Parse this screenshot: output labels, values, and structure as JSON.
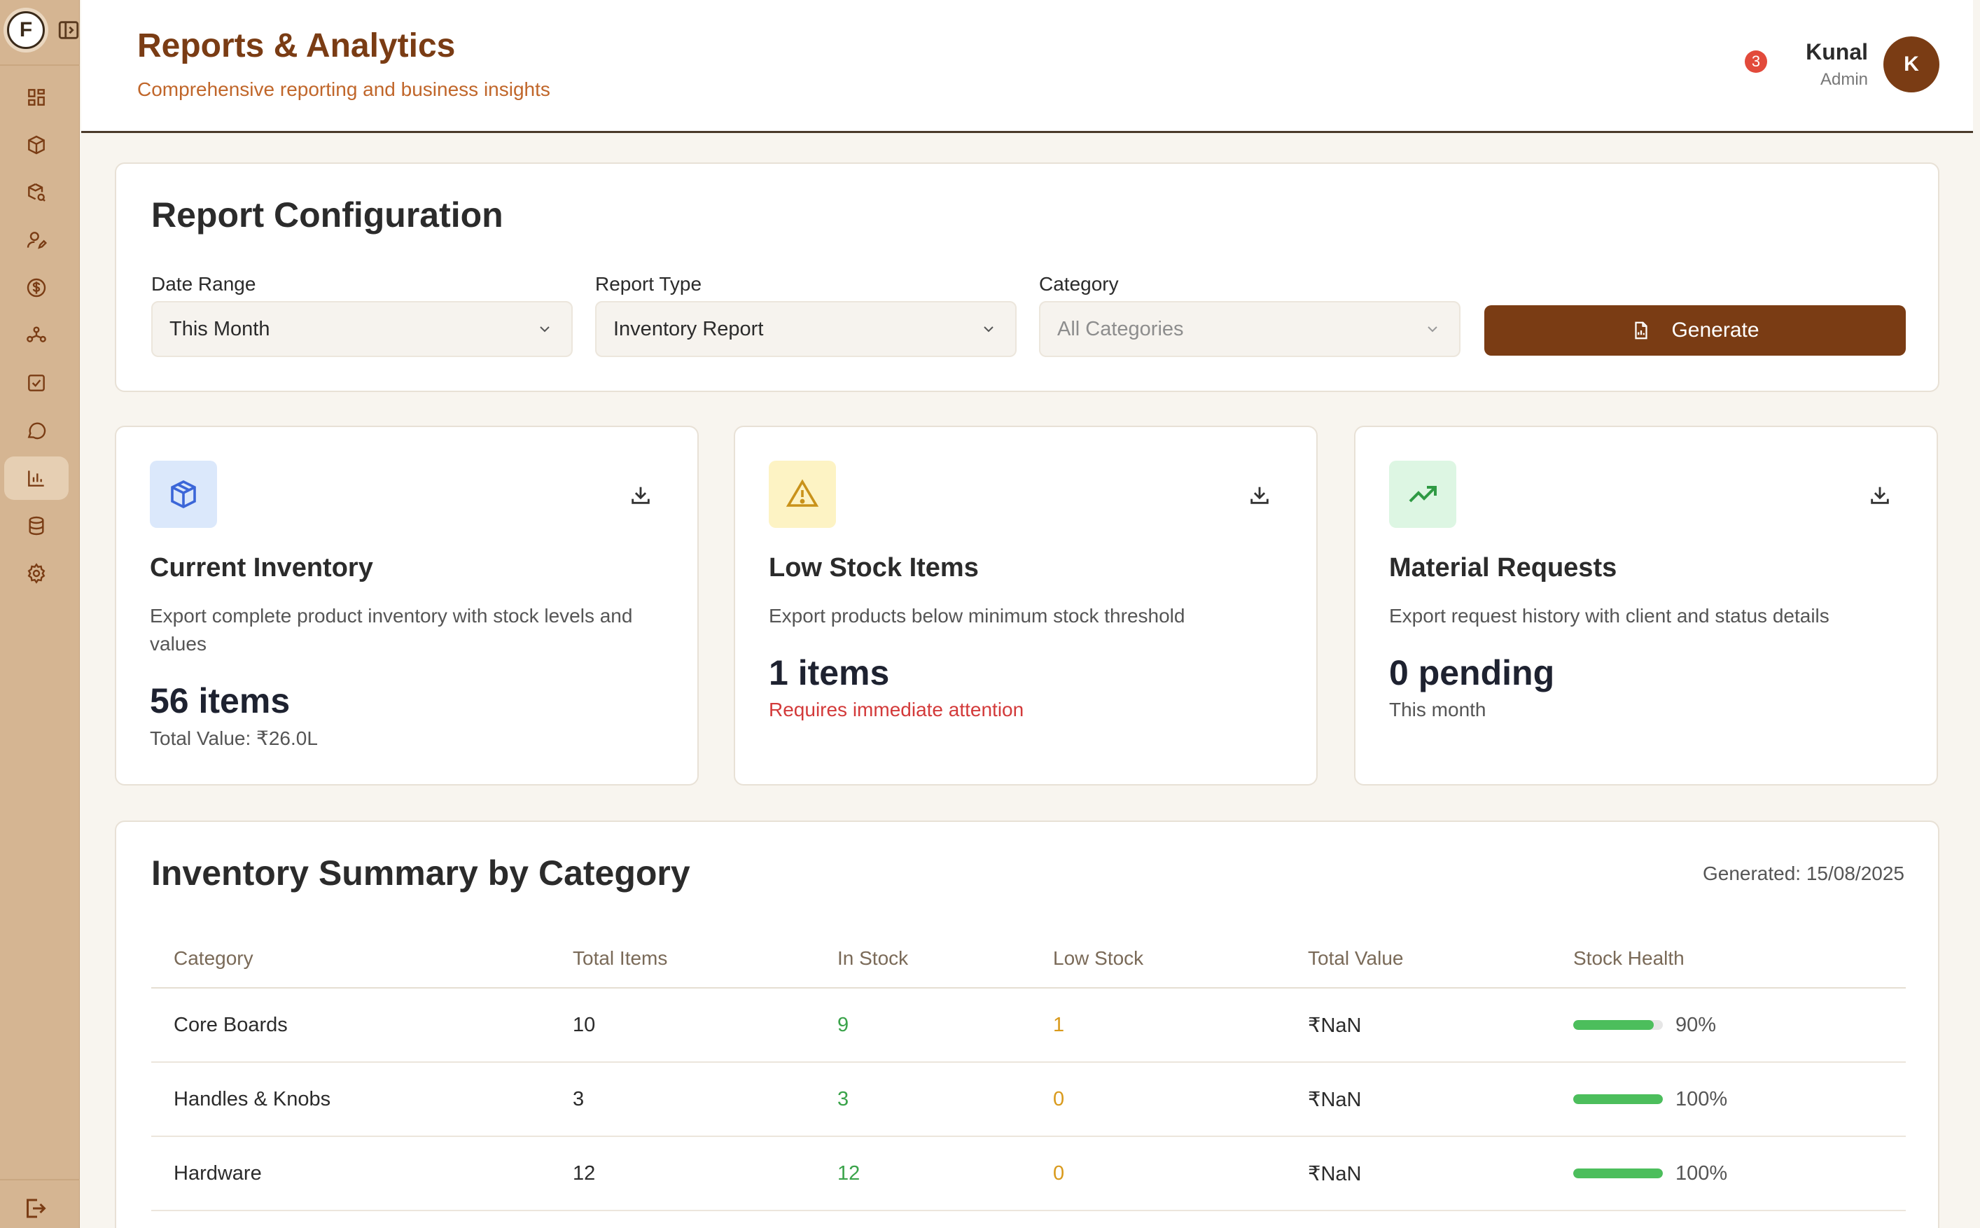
{
  "sidebar": {
    "logo_letter": "F",
    "nav": [
      {
        "icon": "dashboard-grid-icon"
      },
      {
        "icon": "box-icon"
      },
      {
        "icon": "box-search-icon"
      },
      {
        "icon": "user-edit-icon"
      },
      {
        "icon": "dollar-circle-icon"
      },
      {
        "icon": "network-icon"
      },
      {
        "icon": "check-square-icon"
      },
      {
        "icon": "chat-bubble-icon"
      },
      {
        "icon": "bar-chart-icon",
        "active": true
      },
      {
        "icon": "database-icon"
      },
      {
        "icon": "gear-icon"
      }
    ],
    "logout_icon": "logout-icon"
  },
  "header": {
    "title": "Reports & Analytics",
    "subtitle": "Comprehensive reporting and business insights",
    "notification_count": "3",
    "user_name": "Kunal",
    "user_role": "Admin",
    "avatar_letter": "K"
  },
  "config": {
    "title": "Report Configuration",
    "date_range_label": "Date Range",
    "date_range_value": "This Month",
    "report_type_label": "Report Type",
    "report_type_value": "Inventory Report",
    "category_label": "Category",
    "category_value": "All Categories",
    "generate_label": "Generate"
  },
  "stats": [
    {
      "title": "Current Inventory",
      "description": "Export complete product inventory with stock levels and values",
      "value": "56 items",
      "sub": "Total Value: ₹26.0L",
      "icon": "box-icon"
    },
    {
      "title": "Low Stock Items",
      "description": "Export products below minimum stock threshold",
      "value": "1 items",
      "sub": "Requires immediate attention",
      "icon": "warning-icon"
    },
    {
      "title": "Material Requests",
      "description": "Export request history with client and status details",
      "value": "0 pending",
      "sub": "This month",
      "icon": "trending-up-icon"
    }
  ],
  "summary": {
    "title": "Inventory Summary by Category",
    "generated": "Generated: 15/08/2025",
    "columns": [
      "Category",
      "Total Items",
      "In Stock",
      "Low Stock",
      "Total Value",
      "Stock Health"
    ],
    "rows": [
      {
        "category": "Core Boards",
        "total": "10",
        "in_stock": "9",
        "low_stock": "1",
        "value": "₹NaN",
        "health": "90%",
        "health_fraction": 0.9
      },
      {
        "category": "Handles & Knobs",
        "total": "3",
        "in_stock": "3",
        "low_stock": "0",
        "value": "₹NaN",
        "health": "100%",
        "health_fraction": 1.0
      },
      {
        "category": "Hardware",
        "total": "12",
        "in_stock": "12",
        "low_stock": "0",
        "value": "₹NaN",
        "health": "100%",
        "health_fraction": 1.0
      }
    ]
  },
  "colors": {
    "brand": "#7a3c14",
    "sidebar": "#d5b592",
    "success": "#3aa34a",
    "warning": "#d99a1c",
    "danger": "#d33a3a"
  }
}
